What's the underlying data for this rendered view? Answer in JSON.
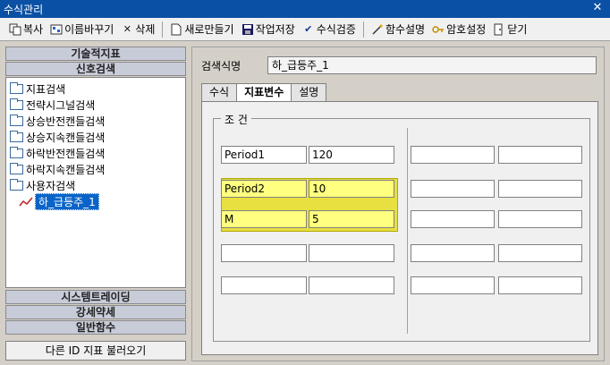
{
  "window": {
    "title": "수식관리"
  },
  "toolbar": {
    "copy": "복사",
    "rename": "이름바꾸기",
    "delete": "삭제",
    "new": "새로만들기",
    "save": "작업저장",
    "verify": "수식검증",
    "func_help": "함수설명",
    "password": "암호설정",
    "close": "닫기"
  },
  "left": {
    "cat_tech": "기술적지표",
    "cat_signal": "신호검색",
    "tree": [
      "지표검색",
      "전략시그널검색",
      "상승반전캔들검색",
      "상승지속캔들검색",
      "하락반전캔들검색",
      "하락지속캔들검색",
      "사용자검색"
    ],
    "child_selected": "하_급등주_1",
    "cat_system": "시스템트레이딩",
    "cat_strength": "강세약세",
    "cat_general": "일반함수",
    "load_button": "다른 ID 지표 불러오기"
  },
  "right": {
    "name_label": "검색식명",
    "name_value": "하_급등주_1",
    "tabs": [
      "수식",
      "지표변수",
      "설명"
    ],
    "group_title": "조 건",
    "params": [
      {
        "name": "Period1",
        "value": "120"
      },
      {
        "name": "Period2",
        "value": "10"
      },
      {
        "name": "M",
        "value": "5"
      },
      {
        "name": "",
        "value": ""
      },
      {
        "name": "",
        "value": ""
      }
    ]
  }
}
